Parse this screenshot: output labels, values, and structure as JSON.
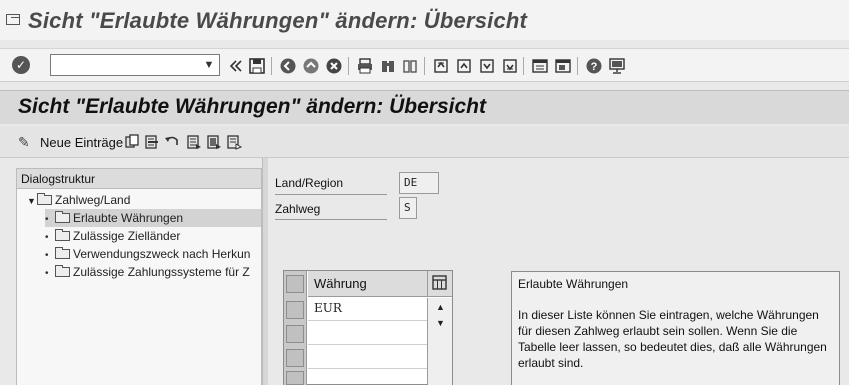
{
  "window": {
    "title": "Sicht \"Erlaubte Währungen\" ändern: Übersicht"
  },
  "toolbar": {
    "command_value": "",
    "icons": [
      "enter-icon",
      "command-dropdown-icon",
      "back-chevrons-icon",
      "save-icon",
      "back-icon",
      "exit-icon",
      "cancel-icon",
      "print-icon",
      "find-icon",
      "find-next-icon",
      "first-page-icon",
      "previous-page-icon",
      "next-page-icon",
      "last-page-icon",
      "new-session-icon",
      "shortcut-icon",
      "help-icon",
      "customize-layout-icon"
    ]
  },
  "header": {
    "title": "Sicht \"Erlaubte Währungen\" ändern: Übersicht"
  },
  "app_toolbar": {
    "new_entries_label": "Neue Einträge",
    "icons": [
      "new-entries-icon",
      "copy-icon",
      "delete-icon",
      "undo-icon",
      "select-all-icon",
      "select-block-icon",
      "deselect-all-icon"
    ]
  },
  "dialog_structure": {
    "heading": "Dialogstruktur",
    "root": "Zahlweg/Land",
    "items": [
      "Erlaubte Währungen",
      "Zulässige Zielländer",
      "Verwendungszweck nach Herkun",
      "Zulässige Zahlungssysteme für Z"
    ],
    "selected_index": 0
  },
  "fields": {
    "land_label": "Land/Region",
    "land_value": "DE",
    "zahlweg_label": "Zahlweg",
    "zahlweg_value": "S"
  },
  "table": {
    "column_header": "Währung",
    "rows": [
      "EUR",
      "",
      "",
      ""
    ]
  },
  "info": {
    "title": "Erlaubte Währungen",
    "body": "In dieser Liste können Sie eintragen, welche Währungen für diesen Zahlweg erlaubt sein sollen. Wenn Sie die Tabelle leer lassen, so bedeutet dies, daß alle Währungen erlaubt sind."
  },
  "colors": {
    "toolbar_bg": "#f3f3f3",
    "header_bg": "#d9d9d9",
    "selected_bg": "#d3d3d3"
  }
}
